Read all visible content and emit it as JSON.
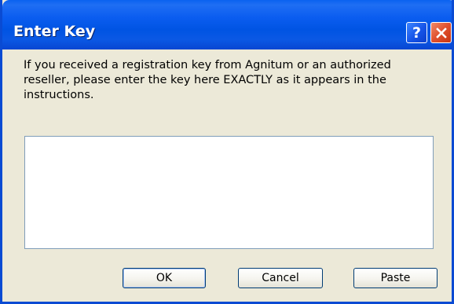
{
  "window": {
    "title": "Enter Key",
    "help_glyph": "?",
    "close_icon": "close-x"
  },
  "content": {
    "instructions": "If you received a registration key from Agnitum or an authorized reseller, please enter the key here EXACTLY as it appears in the instructions.",
    "key_value": ""
  },
  "buttons": {
    "ok_label": "OK",
    "cancel_label": "Cancel",
    "paste_label": "Paste"
  },
  "colors": {
    "titlebar": "#0054e3",
    "dialog_bg": "#ece9d8",
    "close_button": "#e0502d"
  }
}
